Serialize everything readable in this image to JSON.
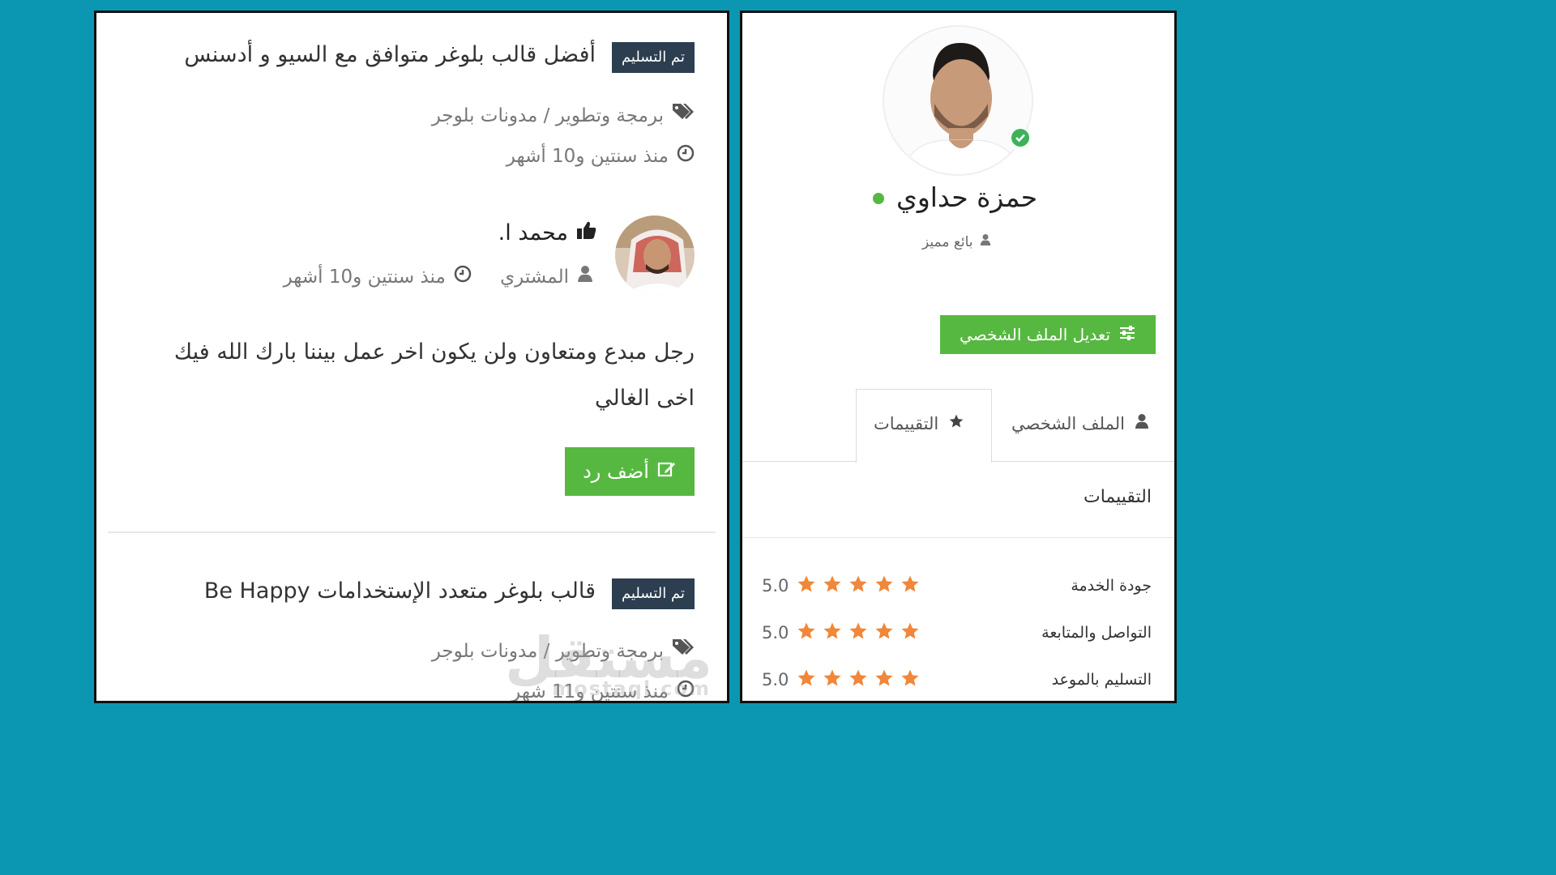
{
  "left": {
    "item1": {
      "badge": "تم التسليم",
      "title": "أفضل قالب بلوغر متوافق مع السيو و أدسنس",
      "category": "برمجة وتطوير / مدونات بلوجر",
      "time": "منذ سنتين و10 أشهر"
    },
    "review": {
      "name": "محمد ا.",
      "role": "المشتري",
      "time": "منذ سنتين و10 أشهر",
      "text": "رجل مبدع ومتعاون ولن يكون اخر عمل بيننا بارك الله فيك اخى الغالي",
      "reply_label": "أضف رد"
    },
    "item2": {
      "badge": "تم التسليم",
      "title": "قالب بلوغر متعدد الإستخدامات Be Happy",
      "category": "برمجة وتطوير / مدونات بلوجر",
      "time": "منذ سنتين و11 شهر"
    }
  },
  "right": {
    "profile_name": "حمزة حداوي",
    "badge": "بائع مميز",
    "edit_button": "تعديل الملف الشخصي",
    "tabs": [
      "الملف الشخصي",
      "التقييمات"
    ],
    "section_title": "التقييمات",
    "ratings": [
      {
        "label": "جودة الخدمة",
        "value": "5.0",
        "stars": 5
      },
      {
        "label": "التواصل والمتابعة",
        "value": "5.0",
        "stars": 5
      },
      {
        "label": "التسليم بالموعد",
        "value": "5.0",
        "stars": 5
      }
    ]
  },
  "watermark": {
    "ar": "مستقل",
    "en": "mostaql.com"
  },
  "colors": {
    "background": "#0b97b1",
    "badge": "#2d3e50",
    "green": "#56b840",
    "star": "#f0873a"
  }
}
